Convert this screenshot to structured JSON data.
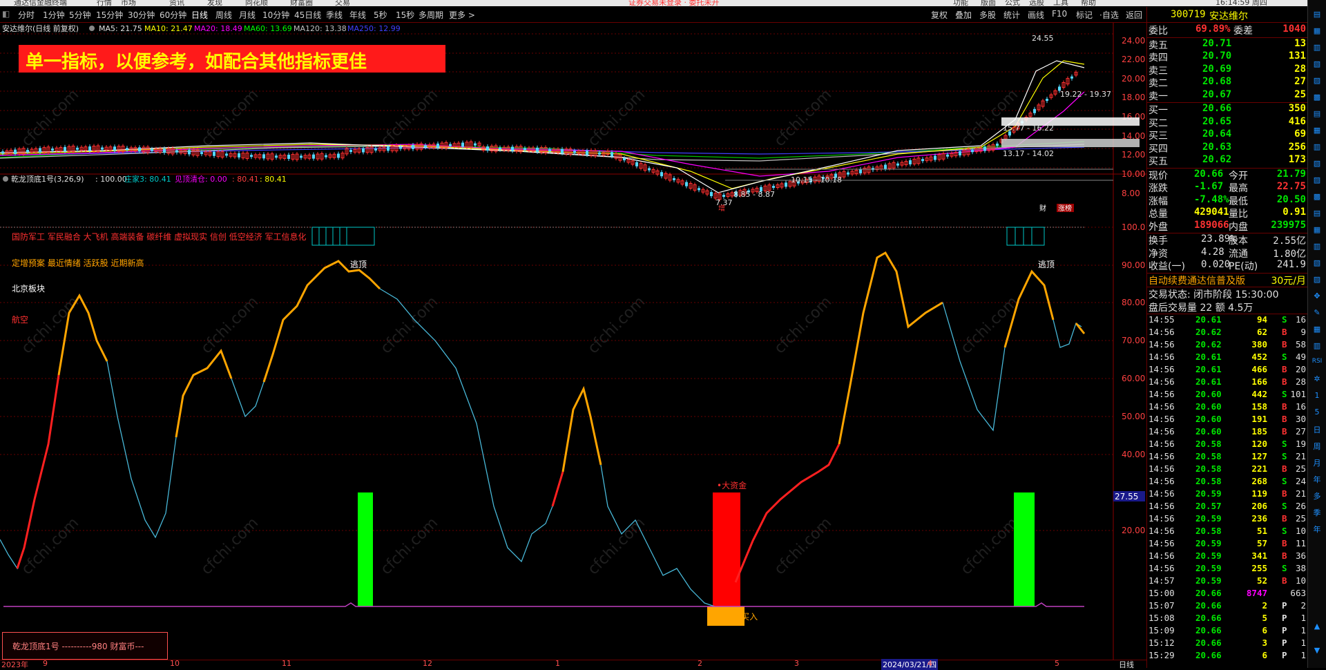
{
  "menubar": {
    "items": [
      "通达信金融终端",
      "行情",
      "市场",
      "资讯",
      "发现",
      "同花顺",
      "财富圈",
      "交易",
      "证券交易未登录 · 委托未开",
      "功能",
      "版面",
      "公式",
      "选股",
      "工具",
      "帮助",
      "16:14:59 周四"
    ]
  },
  "periods": {
    "items": [
      "分时",
      "1分钟",
      "5分钟",
      "15分钟",
      "30分钟",
      "60分钟",
      "日线",
      "周线",
      "月线",
      "10分钟",
      "45日线",
      "季线",
      "年线",
      "5秒",
      "15秒",
      "多周期",
      "更多 >"
    ],
    "active": "日线"
  },
  "right_tools": [
    "复权",
    "叠加",
    "多股",
    "统计",
    "画线",
    "F10",
    "标记",
    "·自选",
    "返回"
  ],
  "stock_header": {
    "name_line": "安达维尔(日线 前复权)",
    "ma5": "MA5: 21.75",
    "ma10": "MA10: 21.47",
    "ma20": "MA20: 18.49",
    "ma60": "MA60: 13.69",
    "ma120": "MA120: 13.38",
    "ma250": "MA250: 12.99"
  },
  "banner": "单一指标，以便参考，如配合其他指标更佳",
  "price_axis": [
    "24.00",
    "22.00",
    "20.00",
    "18.00",
    "16.00",
    "14.00",
    "12.00",
    "10.00",
    "8.00"
  ],
  "price_annotations": {
    "high": "24.55",
    "range1": "19.22 - 19.37",
    "range2": "15.77 - 16.22",
    "range3": "13.17 - 14.02",
    "range4": "10.15 - 10.18",
    "range5": "8.85 - 8.87",
    "low": "7.37",
    "tag_zeng": "增",
    "tag_cai": "财",
    "tag_zhang": "涨榜"
  },
  "indicator_header": {
    "name": "乾龙顶底1号(3,26,9)",
    "v1": ": 100.00",
    "zhuang": "庄家3: 80.41",
    "jian": "见顶清仓: 0.00",
    "v4": ": 80.41",
    "v5": ": 80.41"
  },
  "sectors": [
    "国防军工 军民融合 大飞机 高端装备 碳纤维 虚拟现实 信创 低空经济 军工信息化",
    "定增预案 最近情绪 活跃股 近期新高",
    "北京板块",
    "航空"
  ],
  "osc_axis": [
    "100.0",
    "90.00",
    "80.00",
    "70.00",
    "60.00",
    "50.00",
    "40.00",
    "30.00",
    "20.00"
  ],
  "osc_marker": "27.55",
  "signals": {
    "escape1": "逃顶",
    "escape2": "逃顶",
    "big_money": "•大资金",
    "buy": "•买入"
  },
  "bottom_box": "乾龙顶底1号 ----------980 财富币---",
  "x_axis": {
    "labels": [
      "2023年",
      "9",
      "10",
      "11",
      "12",
      "1",
      "2",
      "3",
      "2024/03/21/四",
      "4",
      "5"
    ],
    "right": "日线"
  },
  "quote": {
    "code": "300719",
    "name": "安达维尔",
    "weibi_label": "委比",
    "weibi": "69.89%",
    "weicha_label": "委差",
    "weicha": "1040",
    "sells": [
      {
        "label": "卖五",
        "price": "20.71",
        "vol": "13"
      },
      {
        "label": "卖四",
        "price": "20.70",
        "vol": "131"
      },
      {
        "label": "卖三",
        "price": "20.69",
        "vol": "28"
      },
      {
        "label": "卖二",
        "price": "20.68",
        "vol": "27"
      },
      {
        "label": "卖一",
        "price": "20.67",
        "vol": "25"
      }
    ],
    "buys": [
      {
        "label": "买一",
        "price": "20.66",
        "vol": "350"
      },
      {
        "label": "买二",
        "price": "20.65",
        "vol": "416"
      },
      {
        "label": "买三",
        "price": "20.64",
        "vol": "69"
      },
      {
        "label": "买四",
        "price": "20.63",
        "vol": "256"
      },
      {
        "label": "买五",
        "price": "20.62",
        "vol": "173"
      }
    ],
    "stats": [
      {
        "l1": "现价",
        "v1": "20.66",
        "l2": "今开",
        "v2": "21.79",
        "c1": "green",
        "c2": "green"
      },
      {
        "l1": "涨跌",
        "v1": "-1.67",
        "l2": "最高",
        "v2": "22.75",
        "c1": "green",
        "c2": "red"
      },
      {
        "l1": "涨幅",
        "v1": "-7.48%",
        "l2": "最低",
        "v2": "20.50",
        "c1": "green",
        "c2": "green"
      },
      {
        "l1": "总量",
        "v1": "429041",
        "l2": "量比",
        "v2": "0.91",
        "c1": "yellow",
        "c2": "yellow"
      },
      {
        "l1": "外盘",
        "v1": "189066",
        "l2": "内盘",
        "v2": "239975",
        "c1": "red",
        "c2": "green"
      }
    ],
    "stats2": [
      {
        "l1": "换手",
        "v1": "23.89%",
        "l2": "股本",
        "v2": "2.55亿"
      },
      {
        "l1": "净资",
        "v1": "4.28",
        "l2": "流通",
        "v2": "1.80亿"
      },
      {
        "l1": "收益(一)",
        "v1": "0.020",
        "l2": "PE(动)",
        "v2": "241.9"
      }
    ],
    "ad": "自动续费通达信普及版",
    "ad_price": "30元/月",
    "trade_state": "交易状态: 闭市阶段 15:30:00",
    "after_hours": "盘后交易量 22 额 4.5万"
  },
  "ticks": [
    {
      "t": "14:55",
      "p": "20.61",
      "v": "94",
      "s": "S",
      "n": "16"
    },
    {
      "t": "14:56",
      "p": "20.62",
      "v": "62",
      "s": "B",
      "n": "9"
    },
    {
      "t": "14:56",
      "p": "20.62",
      "v": "380",
      "s": "B",
      "n": "58"
    },
    {
      "t": "14:56",
      "p": "20.61",
      "v": "452",
      "s": "S",
      "n": "49"
    },
    {
      "t": "14:56",
      "p": "20.61",
      "v": "466",
      "s": "B",
      "n": "20"
    },
    {
      "t": "14:56",
      "p": "20.61",
      "v": "166",
      "s": "B",
      "n": "28"
    },
    {
      "t": "14:56",
      "p": "20.60",
      "v": "442",
      "s": "S",
      "n": "101"
    },
    {
      "t": "14:56",
      "p": "20.60",
      "v": "158",
      "s": "B",
      "n": "16"
    },
    {
      "t": "14:56",
      "p": "20.60",
      "v": "191",
      "s": "B",
      "n": "30"
    },
    {
      "t": "14:56",
      "p": "20.60",
      "v": "185",
      "s": "B",
      "n": "27"
    },
    {
      "t": "14:56",
      "p": "20.58",
      "v": "120",
      "s": "S",
      "n": "19"
    },
    {
      "t": "14:56",
      "p": "20.58",
      "v": "127",
      "s": "S",
      "n": "21"
    },
    {
      "t": "14:56",
      "p": "20.58",
      "v": "221",
      "s": "B",
      "n": "25"
    },
    {
      "t": "14:56",
      "p": "20.58",
      "v": "268",
      "s": "S",
      "n": "24"
    },
    {
      "t": "14:56",
      "p": "20.59",
      "v": "119",
      "s": "B",
      "n": "21"
    },
    {
      "t": "14:56",
      "p": "20.57",
      "v": "206",
      "s": "S",
      "n": "26"
    },
    {
      "t": "14:56",
      "p": "20.59",
      "v": "236",
      "s": "B",
      "n": "25"
    },
    {
      "t": "14:56",
      "p": "20.58",
      "v": "51",
      "s": "S",
      "n": "10"
    },
    {
      "t": "14:56",
      "p": "20.59",
      "v": "57",
      "s": "B",
      "n": "11"
    },
    {
      "t": "14:56",
      "p": "20.59",
      "v": "341",
      "s": "B",
      "n": "36"
    },
    {
      "t": "14:56",
      "p": "20.59",
      "v": "255",
      "s": "S",
      "n": "38"
    },
    {
      "t": "14:57",
      "p": "20.59",
      "v": "52",
      "s": "B",
      "n": "10"
    },
    {
      "t": "15:00",
      "p": "20.66",
      "v": "8747",
      "s": "",
      "n": "663"
    },
    {
      "t": "15:07",
      "p": "20.66",
      "v": "2",
      "s": "P",
      "n": "2"
    },
    {
      "t": "15:08",
      "p": "20.66",
      "v": "5",
      "s": "P",
      "n": "1"
    },
    {
      "t": "15:09",
      "p": "20.66",
      "v": "6",
      "s": "P",
      "n": "1"
    },
    {
      "t": "15:12",
      "p": "20.66",
      "v": "3",
      "s": "P",
      "n": "1"
    },
    {
      "t": "15:29",
      "p": "20.66",
      "v": "6",
      "s": "P",
      "n": "1"
    }
  ],
  "side_icons": [
    "rsi-icon",
    "gear-icon"
  ],
  "side_letters": [
    "日",
    "周",
    "月",
    "年",
    "多",
    "季",
    "年"
  ]
}
